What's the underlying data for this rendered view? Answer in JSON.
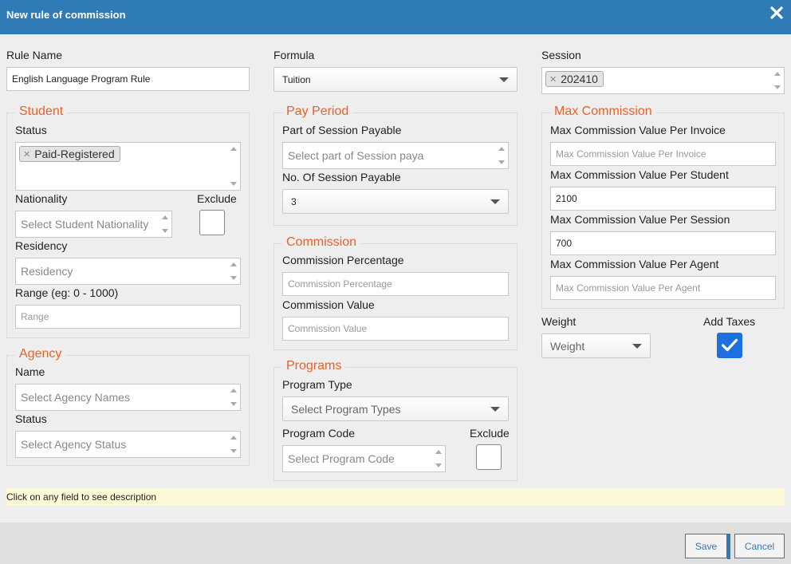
{
  "dialog": {
    "title": "New rule of commission"
  },
  "rule_name": {
    "label": "Rule Name",
    "value": "English Language Program Rule"
  },
  "formula": {
    "label": "Formula",
    "value": "Tuition"
  },
  "session": {
    "label": "Session",
    "tag": "202410"
  },
  "student": {
    "legend": "Student",
    "status_label": "Status",
    "status_tag": "Paid-Registered",
    "nationality_label": "Nationality",
    "nationality_placeholder": "Select Student Nationality",
    "exclude_label": "Exclude",
    "exclude_checked": false,
    "residency_label": "Residency",
    "residency_placeholder": "Residency",
    "range_label": "Range (eg: 0 - 1000)",
    "range_placeholder": "Range"
  },
  "agency": {
    "legend": "Agency",
    "name_label": "Name",
    "name_placeholder": "Select Agency Names",
    "status_label": "Status",
    "status_placeholder": "Select Agency Status"
  },
  "pay_period": {
    "legend": "Pay Period",
    "part_label": "Part of Session Payable",
    "part_placeholder": "Select part of Session paya",
    "count_label": "No. Of Session Payable",
    "count_value": "3"
  },
  "commission": {
    "legend": "Commission",
    "percentage_label": "Commission Percentage",
    "percentage_placeholder": "Commission Percentage",
    "value_label": "Commission Value",
    "value_placeholder": "Commission Value"
  },
  "programs": {
    "legend": "Programs",
    "type_label": "Program Type",
    "type_placeholder": "Select Program Types",
    "code_label": "Program Code",
    "code_placeholder": "Select Program Code",
    "exclude_label": "Exclude",
    "exclude_checked": false
  },
  "max_commission": {
    "legend": "Max Commission",
    "per_invoice_label": "Max Commission Value Per Invoice",
    "per_invoice_placeholder": "Max Commission Value Per Invoice",
    "per_student_label": "Max Commission Value Per Student",
    "per_student_value": "2100",
    "per_session_label": "Max Commission Value Per Session",
    "per_session_value": "700",
    "per_agent_label": "Max Commission Value Per Agent",
    "per_agent_placeholder": "Max Commission Value Per Agent"
  },
  "weight": {
    "label": "Weight",
    "placeholder": "Weight"
  },
  "add_taxes": {
    "label": "Add Taxes",
    "checked": true
  },
  "description_hint": "Click on any field to see description",
  "footer": {
    "save_label": "Save",
    "cancel_label": "Cancel"
  },
  "colors": {
    "header": "#2f7bb5",
    "legend": "#e8622a",
    "checkbox_checked": "#1e6fe0",
    "hint_bg": "#fdfbd7"
  },
  "icons": {
    "close": "close-icon",
    "remove_tag": "remove-tag-icon",
    "dropdown": "chevron-down-icon",
    "check": "check-icon"
  }
}
